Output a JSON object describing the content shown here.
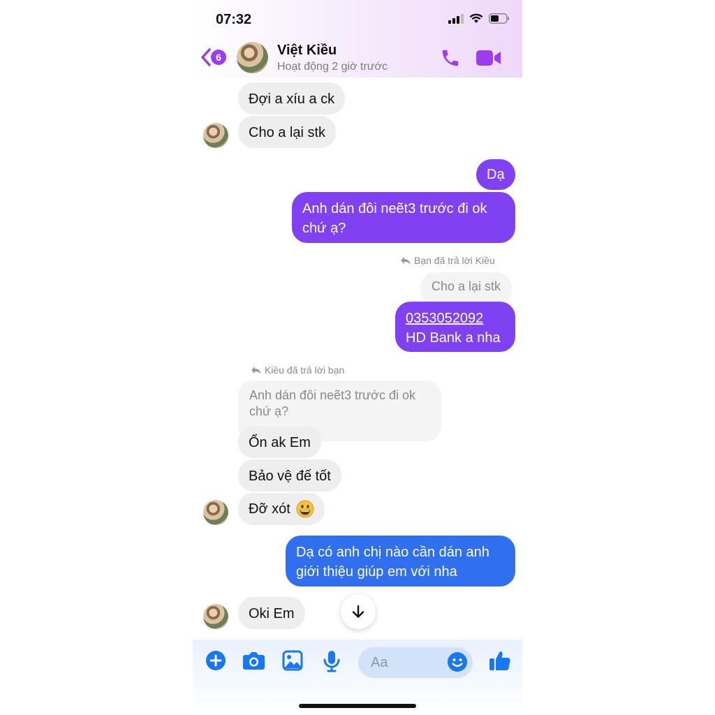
{
  "status_bar": {
    "time": "07:32"
  },
  "header": {
    "back_badge": "6",
    "contact_name": "Việt Kiều",
    "contact_status": "Hoạt động 2 giờ trước"
  },
  "messages": {
    "m1": "Đợi a xíu a ck",
    "m2": "Cho a lại stk",
    "m3": "Dạ",
    "m4_line1": "Anh dán đôi neẽt3 trước đi ok",
    "m4_line2": "chứ ạ?",
    "reply_note_1": "Bạn đã trả lời Kiều",
    "quoted_1": "Cho a lại stk",
    "m5_line1": "0353052092",
    "m5_line2": "HD Bank a nha",
    "reply_note_2": "Kiều đã trả lời bạn",
    "quoted_2_line1": "Anh dán đôi neẽt3 trước đi ok",
    "quoted_2_line2": "chứ ạ?",
    "m6": "Ổn ak Em",
    "m7": "Bảo vệ đế tốt",
    "m8": "Đỡ xót",
    "m9_line1": "Dạ có anh chị nào cần dán anh",
    "m9_line2": "giới thiệu giúp em với nha",
    "m10": "Oki Em"
  },
  "composer": {
    "placeholder": "Aa"
  },
  "colors": {
    "accent_purple": "#8041f3",
    "accent_blue": "#2f6ff0",
    "icon_blue": "#1877f2",
    "icon_purple": "#9b3cf0"
  },
  "icons": [
    "back-chevron-icon",
    "phone-icon",
    "video-camera-icon",
    "reply-arrow-icon",
    "arrow-down-icon",
    "plus-icon",
    "camera-icon",
    "image-icon",
    "microphone-icon",
    "smiley-icon",
    "thumbs-up-icon",
    "emoji-grinning"
  ]
}
